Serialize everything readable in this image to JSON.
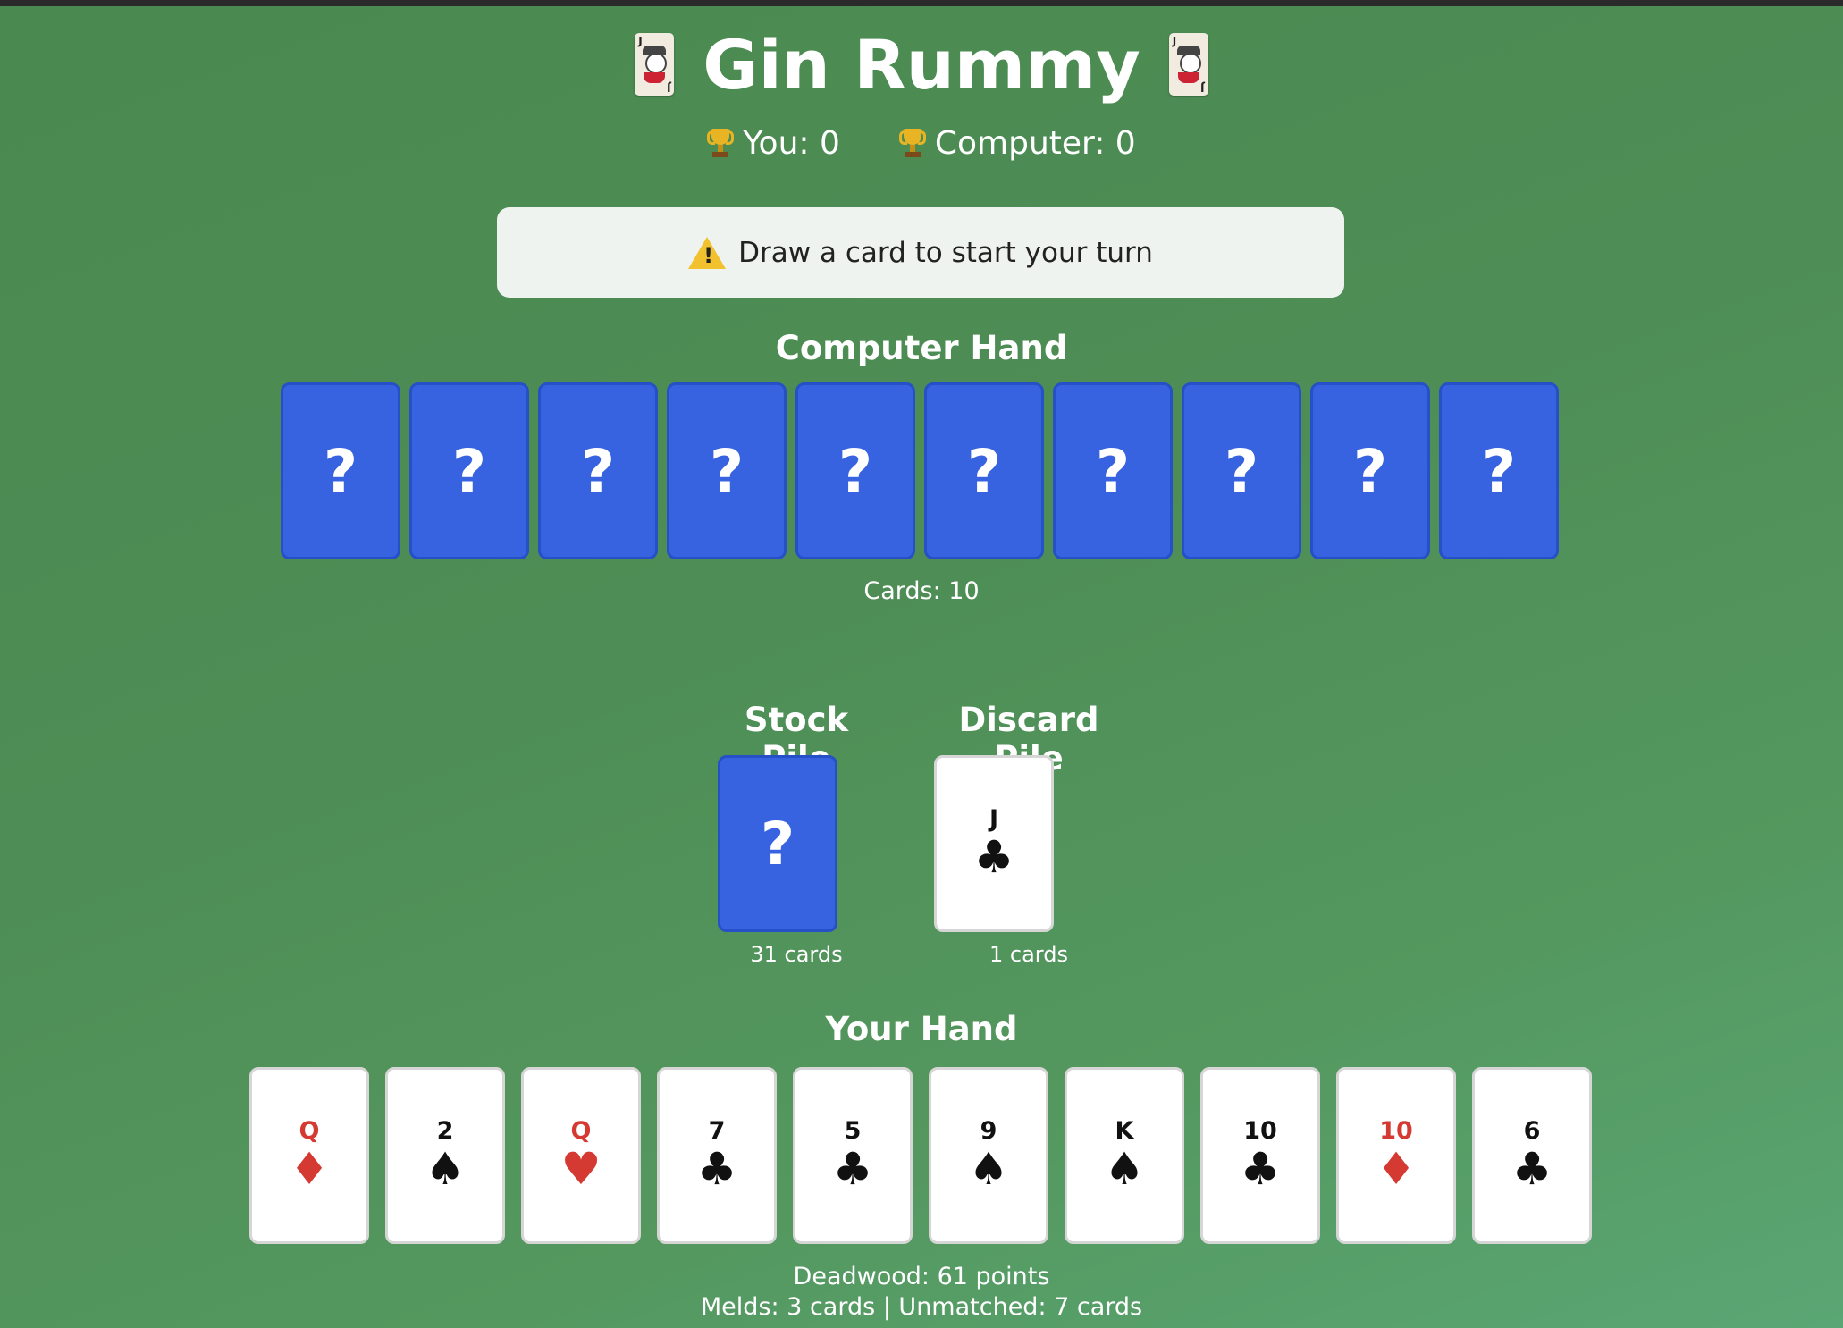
{
  "title": "Gin Rummy",
  "scores": {
    "you": "You: 0",
    "computer": "Computer: 0"
  },
  "status_message": "Draw a card to start your turn",
  "computer_hand": {
    "label": "Computer Hand",
    "hidden_card_glyph": "?",
    "count_text": "Cards: 10",
    "count": 10
  },
  "stock_pile": {
    "label": "Stock Pile",
    "glyph": "?",
    "count_text": "31 cards"
  },
  "discard_pile": {
    "label": "Discard Pile",
    "top_card": {
      "rank": "J",
      "suit": "♣",
      "color": "black"
    },
    "count_text": "1 cards"
  },
  "your_hand": {
    "label": "Your Hand",
    "cards": [
      {
        "rank": "Q",
        "suit": "♦",
        "color": "red"
      },
      {
        "rank": "2",
        "suit": "♠",
        "color": "black"
      },
      {
        "rank": "Q",
        "suit": "♥",
        "color": "red"
      },
      {
        "rank": "7",
        "suit": "♣",
        "color": "black"
      },
      {
        "rank": "5",
        "suit": "♣",
        "color": "black"
      },
      {
        "rank": "9",
        "suit": "♠",
        "color": "black"
      },
      {
        "rank": "K",
        "suit": "♠",
        "color": "black"
      },
      {
        "rank": "10",
        "suit": "♣",
        "color": "black"
      },
      {
        "rank": "10",
        "suit": "♦",
        "color": "red"
      },
      {
        "rank": "6",
        "suit": "♣",
        "color": "black"
      }
    ],
    "deadwood_text": "Deadwood: 61 points",
    "melds_text": "Melds: 3 cards | Unmatched: 7 cards"
  },
  "colors": {
    "card_back": "#3763e0",
    "table": "#4e8e56",
    "red_suit": "#d43a32"
  }
}
